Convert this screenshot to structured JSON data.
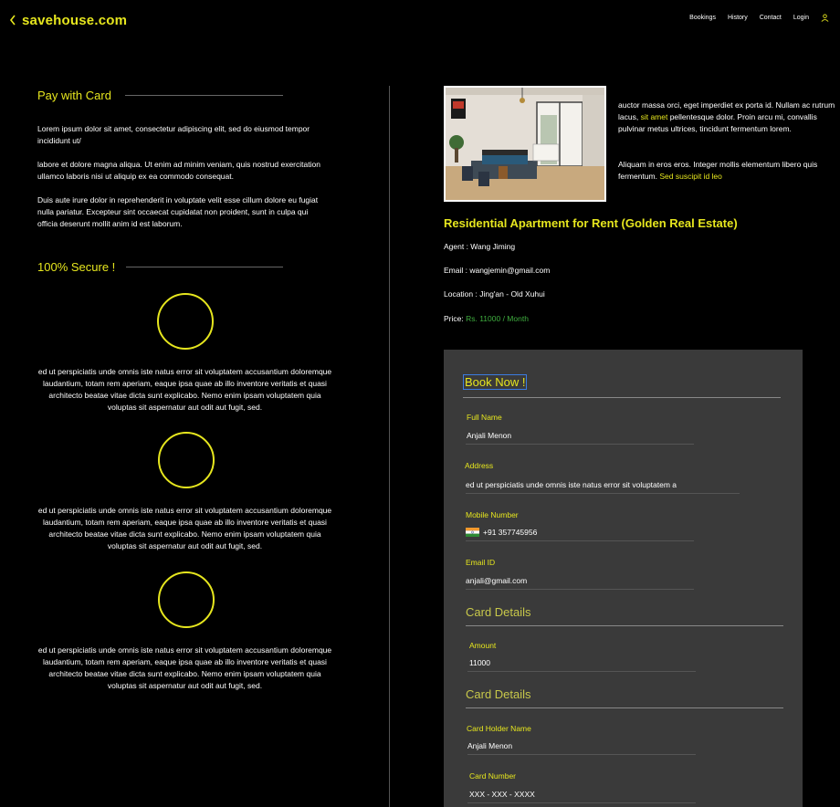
{
  "header": {
    "brand": "savehouse.com",
    "nav": [
      "Bookings",
      "History",
      "Contact",
      "Login"
    ]
  },
  "left": {
    "pay_title": "Pay with Card",
    "paragraphs": [
      "Lorem ipsum dolor sit amet, consectetur adipiscing elit, sed do eiusmod tempor incididunt ut/",
      "labore et dolore magna aliqua. Ut enim ad minim veniam, quis nostrud exercitation ullamco laboris nisi ut aliquip ex ea commodo consequat.",
      "Duis aute irure dolor in reprehenderit in voluptate velit esse cillum dolore eu fugiat nulla pariatur. Excepteur sint occaecat cupidatat non proident, sunt in culpa qui officia deserunt mollit anim id est laborum."
    ],
    "secure_title": "100% Secure !",
    "features": [
      "ed ut perspiciatis unde omnis iste natus error sit voluptatem accusantium doloremque laudantium, totam rem aperiam, eaque ipsa quae ab illo inventore veritatis et quasi architecto beatae vitae dicta sunt explicabo. Nemo enim ipsam voluptatem quia voluptas sit aspernatur aut odit aut fugit, sed.",
      "ed ut perspiciatis unde omnis iste natus error sit voluptatem accusantium doloremque laudantium, totam rem aperiam, eaque ipsa quae ab illo inventore veritatis et quasi architecto beatae vitae dicta sunt explicabo. Nemo enim ipsam voluptatem quia voluptas sit aspernatur aut odit aut fugit, sed.",
      "ed ut perspiciatis unde omnis iste natus error sit voluptatem accusantium doloremque laudantium, totam rem aperiam, eaque ipsa quae ab illo inventore veritatis et quasi architecto beatae vitae dicta sunt explicabo. Nemo enim ipsam voluptatem quia voluptas sit aspernatur aut odit aut fugit, sed."
    ]
  },
  "listing": {
    "desc1_a": "auctor massa orci, eget imperdiet ex porta id. Nullam ac rutrum lacus, ",
    "desc1_link": "sit amet",
    "desc1_b": " pellentesque dolor. Proin arcu mi, convallis pulvinar metus ultrices, tincidunt fermentum lorem.",
    "desc2_a": "Aliquam in eros eros. Integer mollis elementum libero quis fermentum. ",
    "desc2_link": "Sed suscipit id leo",
    "title": "Residential Apartment for Rent (Golden Real Estate)",
    "agent": "Agent : Wang Jiming",
    "email": "Email : wangjemin@gmail.com",
    "location": "Location : Jing'an - Old Xuhui",
    "price_label": "Price: ",
    "price_value": "Rs. 11000 / Month"
  },
  "form": {
    "title": "Book Now !",
    "full_name_label": "Full Name",
    "full_name": "Anjali Menon",
    "address_label": "Address",
    "address": "ed ut perspiciatis unde omnis iste natus error sit voluptatem a",
    "mobile_label": "Mobile Number",
    "mobile": "+91 357745956",
    "email_label": "Email ID",
    "email": "anjali@gmail.com",
    "card_details_1": "Card Details",
    "amount_label": "Amount",
    "amount": "11000",
    "card_details_2": "Card Details",
    "holder_label": "Card Holder Name",
    "holder": "Anjali Menon",
    "card_number_label": "Card Number",
    "card_number": "XXX - XXX - XXXX"
  },
  "colors": {
    "accent": "#e6e61e",
    "background": "#000000",
    "card": "#3a3a3a",
    "price": "#3fae3f"
  }
}
